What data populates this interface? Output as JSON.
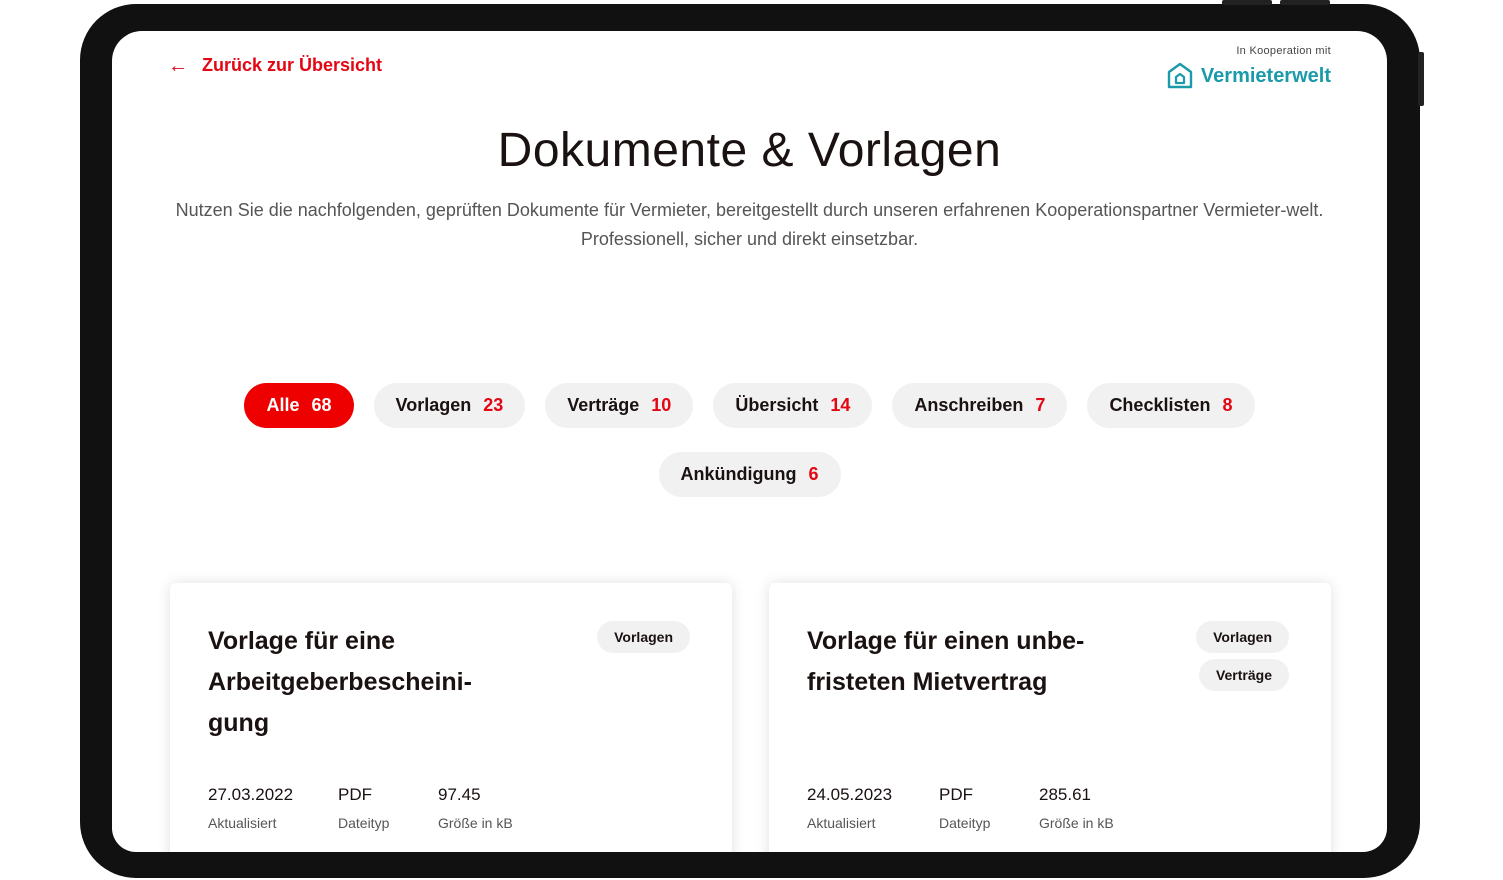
{
  "nav": {
    "back_label": "Zurück zur Übersicht"
  },
  "cooperation": {
    "label": "In Kooperation mit",
    "brand": "Vermieterwelt",
    "brand_color": "#1b9aaa"
  },
  "page": {
    "title": "Dokumente & Vorlagen",
    "subtitle": "Nutzen Sie die nachfolgenden, geprüften Dokumente für Vermieter, bereitgestellt durch unseren erfahrenen Kooperationspartner Vermieter-welt. Professionell, sicher und direkt einsetzbar."
  },
  "filters": [
    {
      "label": "Alle",
      "count": "68",
      "active": true
    },
    {
      "label": "Vorlagen",
      "count": "23"
    },
    {
      "label": "Verträge",
      "count": "10"
    },
    {
      "label": "Übersicht",
      "count": "14"
    },
    {
      "label": "Anschreiben",
      "count": "7"
    },
    {
      "label": "Checklisten",
      "count": "8"
    },
    {
      "label": "Ankündigung",
      "count": "6"
    }
  ],
  "cards": [
    {
      "title": "Vorlage für eine Arbeitgeberbescheini-gung",
      "tags": [
        "Vorlagen"
      ],
      "date": "27.03.2022",
      "date_label": "Aktualisiert",
      "type": "PDF",
      "type_label": "Dateityp",
      "size": "97.45",
      "size_label": "Größe in kB"
    },
    {
      "title": "Vorlage für einen unbe-fristeten Mietvertrag",
      "tags": [
        "Vorlagen",
        "Verträge"
      ],
      "date": "24.05.2023",
      "date_label": "Aktualisiert",
      "type": "PDF",
      "type_label": "Dateityp",
      "size": "285.61",
      "size_label": "Größe in kB"
    }
  ],
  "colors": {
    "accent": "#e30613",
    "active_chip": "#ee0000",
    "chip_bg": "#f1f1f1"
  }
}
